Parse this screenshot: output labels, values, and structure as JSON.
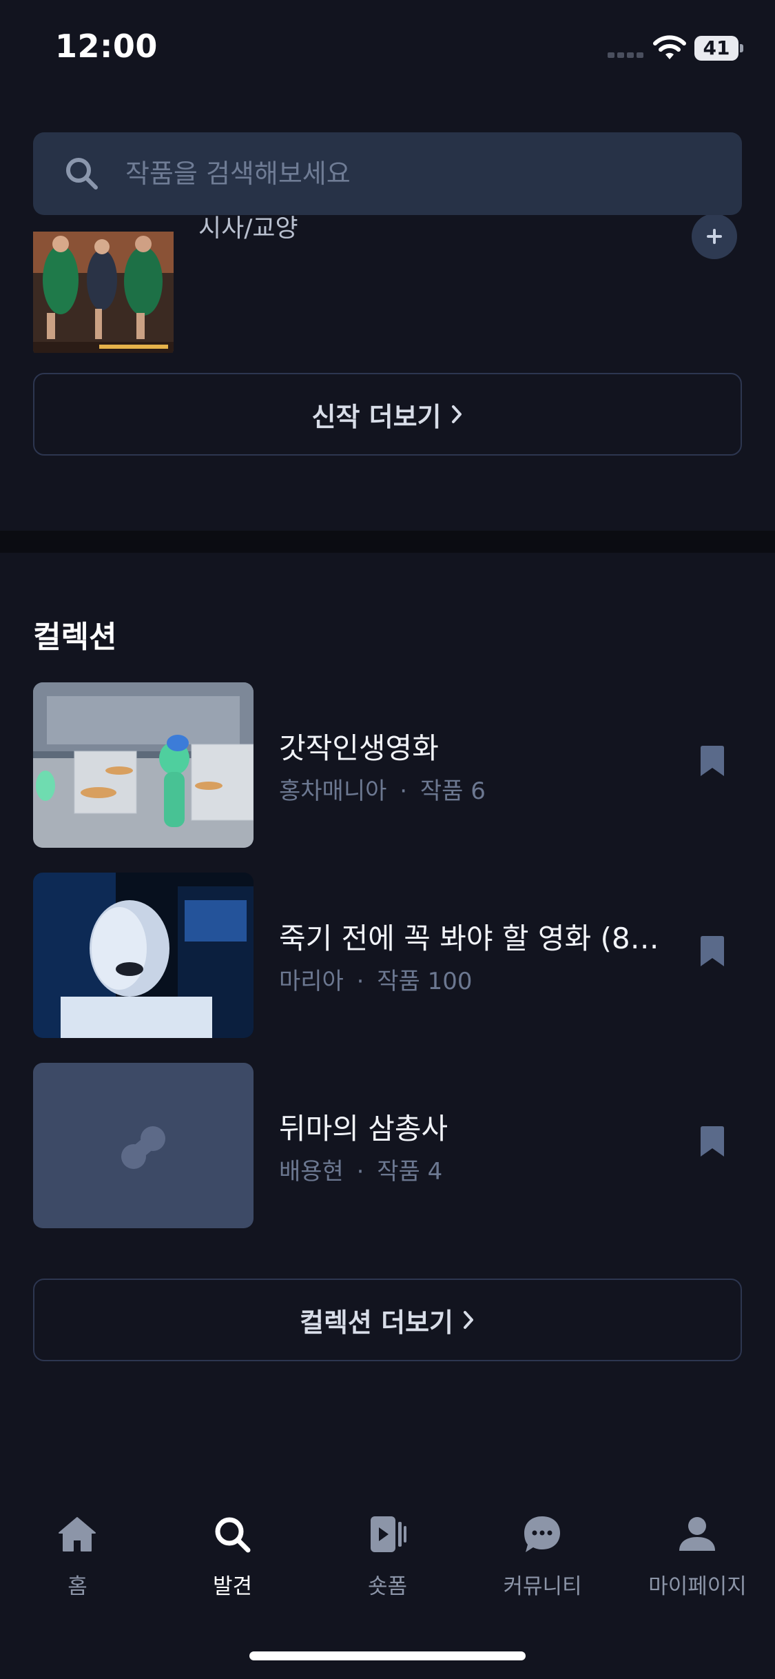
{
  "status_bar": {
    "time": "12:00",
    "battery": "41"
  },
  "search": {
    "placeholder": "작품을 검색해보세요"
  },
  "new_releases": {
    "partial_item_label": "시사/교양",
    "more_label": "신작 더보기"
  },
  "collections": {
    "title": "컬렉션",
    "items": [
      {
        "title": "갓작인생영화",
        "author": "홍차매니아",
        "count_label": "작품 6"
      },
      {
        "title": "죽기 전에 꼭 봐야 할 영화 (8…",
        "author": "마리아",
        "count_label": "작품 100"
      },
      {
        "title": "뒤마의 삼총사",
        "author": "배용현",
        "count_label": "작품 4"
      }
    ],
    "separator": "·",
    "more_label": "컬렉션 더보기"
  },
  "bottom_nav": {
    "items": [
      {
        "label": "홈",
        "icon": "home-icon",
        "active": false
      },
      {
        "label": "발견",
        "icon": "search-icon",
        "active": true
      },
      {
        "label": "숏폼",
        "icon": "short-video-icon",
        "active": false
      },
      {
        "label": "커뮤니티",
        "icon": "chat-bubble-icon",
        "active": false
      },
      {
        "label": "마이페이지",
        "icon": "profile-icon",
        "active": false
      }
    ]
  },
  "colors": {
    "background": "#12141f",
    "search_bg": "#273247",
    "muted_text": "#6c7891",
    "bookmark": "#5a6a8a"
  }
}
